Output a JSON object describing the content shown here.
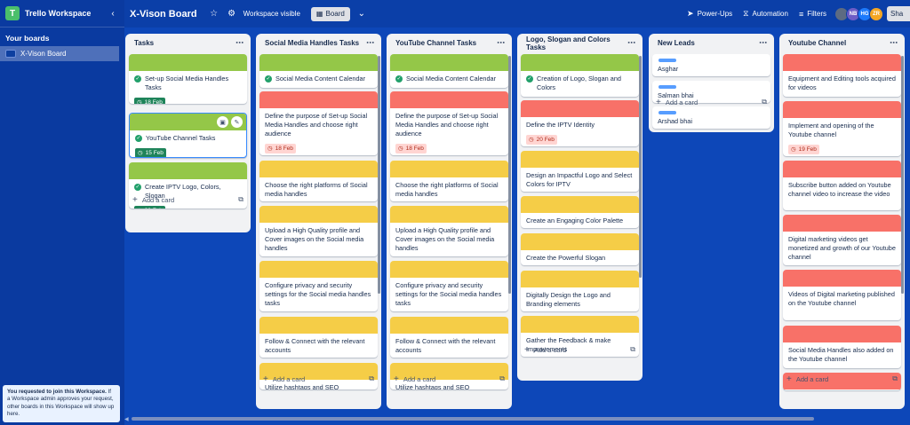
{
  "workspace": {
    "logo_letter": "T",
    "name": "Trello Workspace",
    "collapse_icon": "chevron-left-icon",
    "your_boards_label": "Your boards",
    "boards": [
      "X-Vison Board"
    ]
  },
  "notice": {
    "bold": "You requested to join this Workspace.",
    "text": " If a Workspace admin approves your request, other boards in this Workspace will show up here."
  },
  "topbar": {
    "board_title": "X-Vison Board",
    "star_icon": "star-icon",
    "visibility_label": "Workspace visible",
    "view_label": "Board",
    "powerups_label": "Power-Ups",
    "automation_label": "Automation",
    "filters_label": "Filters",
    "share_label": "Sha",
    "avatars": [
      {
        "initials": "",
        "color": "#5d6b82"
      },
      {
        "initials": "NB",
        "color": "#6e5dc6"
      },
      {
        "initials": "HG",
        "color": "#1d7afc"
      },
      {
        "initials": "ZR",
        "color": "#f5a623"
      }
    ]
  },
  "colors": {
    "green": "#94c748",
    "red": "#f87168",
    "yellow": "#f5cd47",
    "blue_label": "#579dff"
  },
  "lists": [
    {
      "title": "Tasks",
      "add_label": "Add a card",
      "cards": [
        {
          "cover": "green",
          "text": "Set-up Social Media Handles Tasks",
          "checked": true,
          "badge": "18 Feb",
          "badge_type": "done"
        },
        {
          "cover": "green",
          "text": "YouTube Channel Tasks",
          "checked": true,
          "badge": "15 Feb",
          "badge_type": "done",
          "active": true
        },
        {
          "cover": "green",
          "text": "Create IPTV Logo, Colors, Slogan",
          "checked": true,
          "badge": "20 Feb",
          "badge_type": "done"
        }
      ]
    },
    {
      "title": "Social Media Handles Tasks",
      "add_label": "Add a card",
      "cards": [
        {
          "cover": "green",
          "text": "Social Media Content Calendar",
          "checked": true
        },
        {
          "cover": "red",
          "text": "Define the purpose of Set-up Social Media Handles and choose right audience",
          "badge": "18 Feb",
          "badge_type": "due"
        },
        {
          "cover": "yellow",
          "text": "Choose the right platforms of Social media handles"
        },
        {
          "cover": "yellow",
          "text": "Upload a High Quality profile and Cover images on the Social media handles"
        },
        {
          "cover": "yellow",
          "text": "Configure privacy and security settings for the Social media handles tasks"
        },
        {
          "cover": "yellow",
          "text": "Follow & Connect with the relevant accounts"
        },
        {
          "cover": "yellow",
          "text": "Utilize hashtags and SEO"
        }
      ]
    },
    {
      "title": "YouTube Channel Tasks",
      "add_label": "Add a card",
      "cards": [
        {
          "cover": "green",
          "text": "Social Media Content Calendar",
          "checked": true
        },
        {
          "cover": "red",
          "text": "Define the purpose of Set-up Social Media Handles and choose right audience",
          "badge": "18 Feb",
          "badge_type": "due"
        },
        {
          "cover": "yellow",
          "text": "Choose the right platforms of Social media handles"
        },
        {
          "cover": "yellow",
          "text": "Upload a High Quality profile and Cover images on the Social media handles"
        },
        {
          "cover": "yellow",
          "text": "Configure privacy and security settings for the Social media handles tasks"
        },
        {
          "cover": "yellow",
          "text": "Follow & Connect with the relevant accounts"
        },
        {
          "cover": "yellow",
          "text": "Utilize hashtags and SEO"
        }
      ]
    },
    {
      "title": "Logo, Slogan and Colors Tasks",
      "add_label": "Add a card",
      "cards": [
        {
          "cover": "green",
          "text": "Creation of Logo, Slogan and Colors",
          "checked": true
        },
        {
          "cover": "red",
          "text": "Define the IPTV Identity",
          "badge": "20 Feb",
          "badge_type": "due"
        },
        {
          "cover": "yellow",
          "text": "Design an Impactful Logo and Select Colors for IPTV"
        },
        {
          "cover": "yellow",
          "text": "Create an Engaging Color Palette"
        },
        {
          "cover": "yellow",
          "text": "Create the Powerful Slogan"
        },
        {
          "cover": "yellow",
          "text": "Digitally Design the Logo and Branding elements"
        },
        {
          "cover": "yellow",
          "text": "Gather the Feedback & make Improvements"
        }
      ]
    },
    {
      "title": "New Leads",
      "add_label": "Add a card",
      "cards": [
        {
          "label": "blue_label",
          "text": "Asghar"
        },
        {
          "label": "blue_label",
          "text": "Salman bhai"
        },
        {
          "label": "blue_label",
          "text": "Arshad bhai"
        }
      ]
    },
    {
      "title": "Youtube Channel",
      "add_label": "Add a card",
      "cards": [
        {
          "cover": "red",
          "text": "Equipment and Editing tools acquired for videos"
        },
        {
          "cover": "red",
          "text": "Implement and opening of the Youtube channel",
          "badge": "19 Feb",
          "badge_type": "due"
        },
        {
          "cover": "red",
          "text": "Subscribe button added on Youtube channel video to increase the video"
        },
        {
          "cover": "red",
          "text": "Digital marketing videos get monetized and growth of our Youtube channel"
        },
        {
          "cover": "red",
          "text": "Videos of Digital marketing published on the Youtube channel"
        },
        {
          "cover": "red",
          "text": "Social Media Handles also added on the Youtube channel"
        },
        {
          "cover": "red",
          "text": ""
        }
      ]
    }
  ]
}
